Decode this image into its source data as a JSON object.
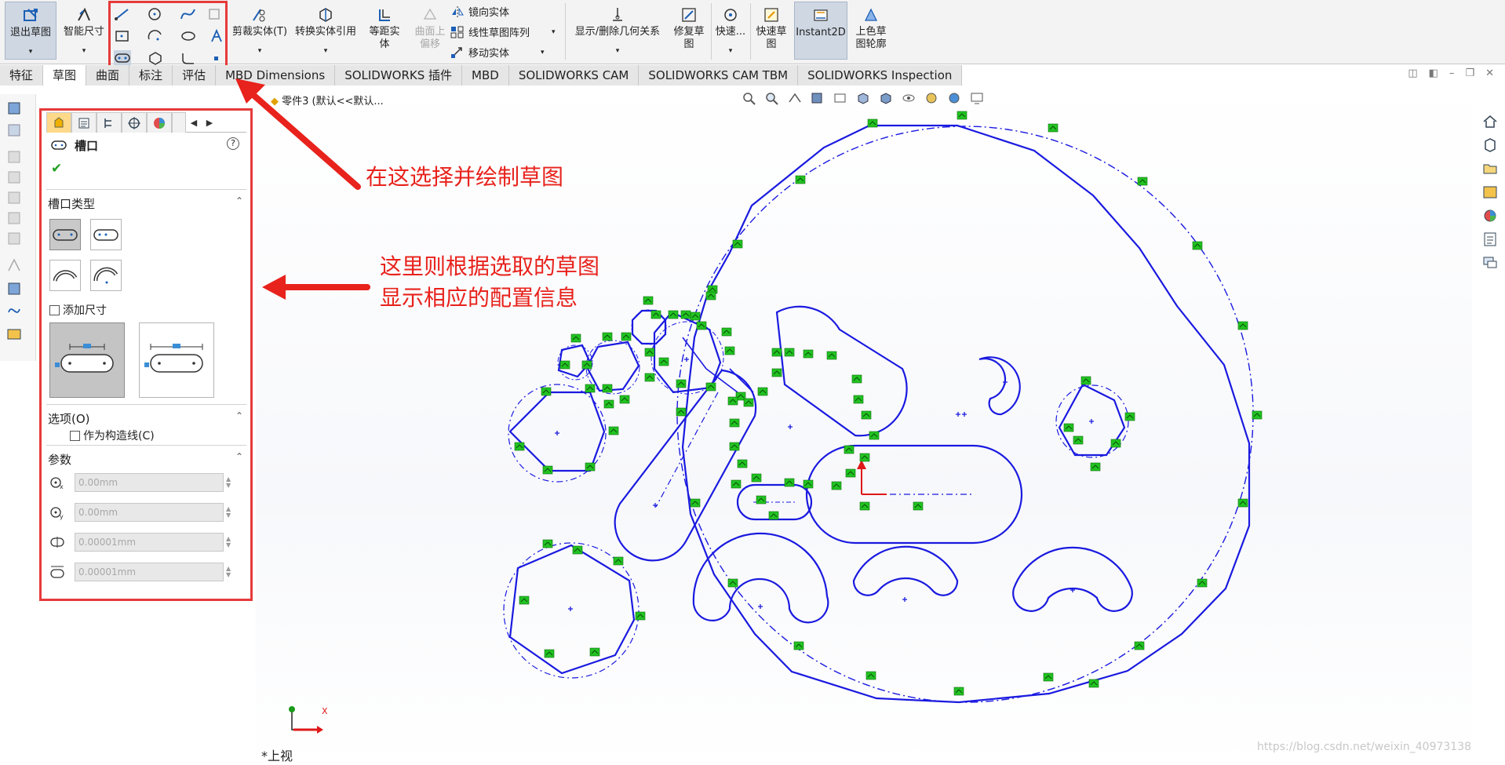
{
  "ribbon": {
    "exit_sketch": "退出草图",
    "smart_dimension": "智能尺寸",
    "trim_entities": "剪裁实体(T)",
    "convert_entities": "转换实体引用",
    "offset_entities_l1": "等距实",
    "offset_entities_l2": "体",
    "offset_on_surface_l1": "曲面上",
    "offset_on_surface_l2": "偏移",
    "mirror_entities": "镜向实体",
    "linear_pattern": "线性草图阵列",
    "move_entities": "移动实体",
    "display_relations": "显示/删除几何关系",
    "repair_sketch_l1": "修复草",
    "repair_sketch_l2": "图",
    "quick_snaps": "快速...",
    "rapid_sketch_l1": "快速草",
    "rapid_sketch_l2": "图",
    "instant2d": "Instant2D",
    "shaded_contours_l1": "上色草",
    "shaded_contours_l2": "图轮廓"
  },
  "tabs": [
    {
      "label": "特征"
    },
    {
      "label": "草图"
    },
    {
      "label": "曲面"
    },
    {
      "label": "标注"
    },
    {
      "label": "评估"
    },
    {
      "label": "MBD Dimensions"
    },
    {
      "label": "SOLIDWORKS 插件"
    },
    {
      "label": "MBD"
    },
    {
      "label": "SOLIDWORKS CAM"
    },
    {
      "label": "SOLIDWORKS CAM TBM"
    },
    {
      "label": "SOLIDWORKS Inspection"
    }
  ],
  "document": {
    "title": "零件3  (默认<<默认...",
    "view_label": "*上视"
  },
  "property_manager": {
    "title": "槽口",
    "help": "?",
    "ok": "✔",
    "slot_type_header": "槽口类型",
    "add_dimensions": "添加尺寸",
    "options_header": "选项(O)",
    "construction": "作为构造线(C)",
    "params_header": "参数",
    "params": [
      {
        "icon": "center-x-icon",
        "value": "0.00mm"
      },
      {
        "icon": "center-y-icon",
        "value": "0.00mm"
      },
      {
        "icon": "slot-width-icon",
        "value": "0.00001mm"
      },
      {
        "icon": "slot-length-icon",
        "value": "0.00001mm"
      }
    ]
  },
  "annotations": {
    "toolbar_note": "在这选择并绘制草图",
    "panel_note_l1": "这里则根据选取的草图",
    "panel_note_l2": "显示相应的配置信息"
  },
  "watermark": "https://blog.csdn.net/weixin_40973138",
  "colors": {
    "sketch": "#1a1ae0",
    "annotation": "#e8221c",
    "relation": "#22c322",
    "ribbon_bg": "#f3f3f3",
    "active_tab": "#ffffff"
  }
}
